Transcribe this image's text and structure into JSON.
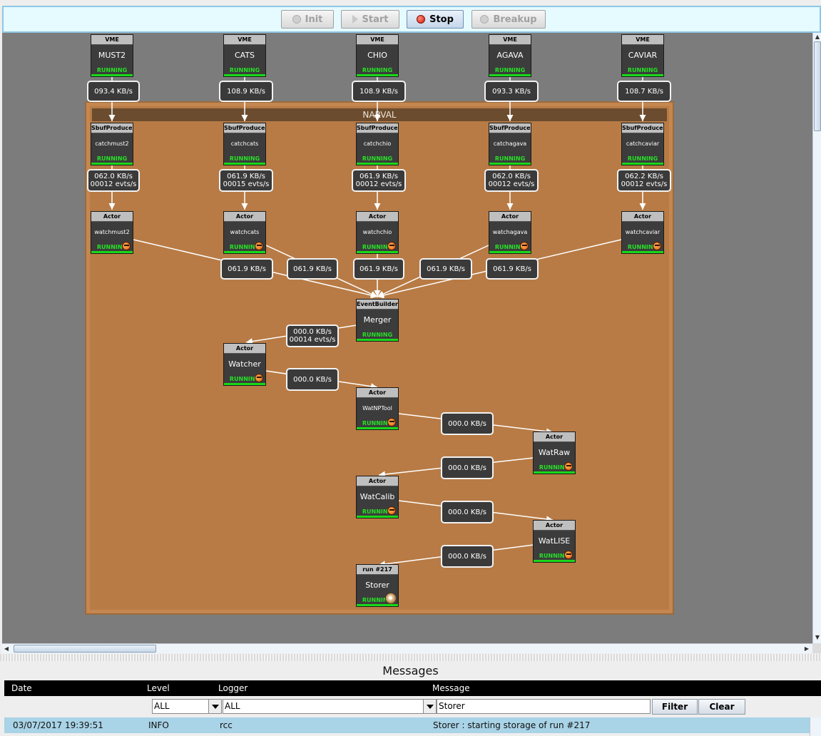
{
  "toolbar": {
    "init": "Init",
    "start": "Start",
    "stop": "Stop",
    "breakup": "Breakup"
  },
  "narval_title": "NARVAL",
  "vme": [
    {
      "type": "VME",
      "name": "MUST2",
      "state": "RUNNING",
      "rate": "093.4 KB/s"
    },
    {
      "type": "VME",
      "name": "CATS",
      "state": "RUNNING",
      "rate": "108.9 KB/s"
    },
    {
      "type": "VME",
      "name": "CHIO",
      "state": "RUNNING",
      "rate": "108.9 KB/s"
    },
    {
      "type": "VME",
      "name": "AGAVA",
      "state": "RUNNING",
      "rate": "093.3 KB/s"
    },
    {
      "type": "VME",
      "name": "CAVIAR",
      "state": "RUNNING",
      "rate": "108.7 KB/s"
    }
  ],
  "producers": [
    {
      "type": "SbufProducer",
      "name": "catchmust2",
      "state": "RUNNING",
      "rate1": "062.0 KB/s",
      "rate2": "00012 evts/s"
    },
    {
      "type": "SbufProducer",
      "name": "catchcats",
      "state": "RUNNING",
      "rate1": "061.9 KB/s",
      "rate2": "00015 evts/s"
    },
    {
      "type": "SbufProducer",
      "name": "catchchio",
      "state": "RUNNING",
      "rate1": "061.9 KB/s",
      "rate2": "00012 evts/s"
    },
    {
      "type": "SbufProducer",
      "name": "catchagava",
      "state": "RUNNING",
      "rate1": "062.0 KB/s",
      "rate2": "00012 evts/s"
    },
    {
      "type": "SbufProducer",
      "name": "catchcaviar",
      "state": "RUNNING",
      "rate1": "062.2 KB/s",
      "rate2": "00012 evts/s"
    }
  ],
  "watchers": [
    {
      "type": "Actor",
      "name": "watchmust2",
      "state": "RUNNING",
      "rate": "061.9 KB/s"
    },
    {
      "type": "Actor",
      "name": "watchcats",
      "state": "RUNNING",
      "rate": "061.9 KB/s"
    },
    {
      "type": "Actor",
      "name": "watchchio",
      "state": "RUNNING",
      "rate": "061.9 KB/s"
    },
    {
      "type": "Actor",
      "name": "watchagava",
      "state": "RUNNING",
      "rate": "061.9 KB/s"
    },
    {
      "type": "Actor",
      "name": "watchcaviar",
      "state": "RUNNING",
      "rate": "061.9 KB/s"
    }
  ],
  "merger": {
    "type": "EventBuilder",
    "name": "Merger",
    "state": "RUNNING",
    "rate1": "000.0 KB/s",
    "rate2": "00014 evts/s"
  },
  "watcher": {
    "type": "Actor",
    "name": "Watcher",
    "state": "RUNNING",
    "rate": "000.0 KB/s"
  },
  "watnptool": {
    "type": "Actor",
    "name": "WatNPTool",
    "state": "RUNNING",
    "rate": "000.0 KB/s"
  },
  "watraw": {
    "type": "Actor",
    "name": "WatRaw",
    "state": "RUNNING",
    "rate": "000.0 KB/s"
  },
  "watcalib": {
    "type": "Actor",
    "name": "WatCalib",
    "state": "RUNNING",
    "rate": "000.0 KB/s"
  },
  "watlise": {
    "type": "Actor",
    "name": "WatLISE",
    "state": "RUNNING",
    "rate": "000.0 KB/s"
  },
  "storer": {
    "type": "run #217",
    "name": "Storer",
    "state": "RUNNING"
  },
  "messages": {
    "title": "Messages",
    "columns": {
      "date": "Date",
      "level": "Level",
      "logger": "Logger",
      "message": "Message"
    },
    "filter": {
      "level": "ALL",
      "logger": "ALL",
      "message": "Storer",
      "filter_btn": "Filter",
      "clear_btn": "Clear"
    },
    "rows": [
      {
        "date": "03/07/2017 19:39:51",
        "level": "INFO",
        "logger": "rcc",
        "message": "Storer : starting storage of run #217"
      }
    ]
  },
  "colors": {
    "narval_bg": "#b87b45",
    "running": "#18d818",
    "canvas": "#7c7c7c"
  }
}
